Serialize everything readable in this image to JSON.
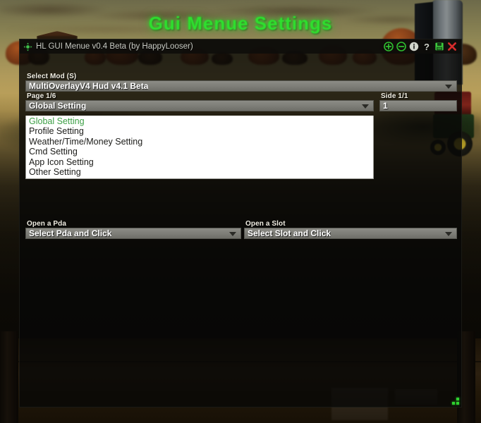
{
  "page": {
    "title": "Gui Menue Settings"
  },
  "window": {
    "titlebar": {
      "icon": "move-crosshair-icon",
      "title": "HL GUI Menue v0.4 Beta (by HappyLooser)",
      "buttons": [
        {
          "name": "zoom-in-button",
          "label": "+",
          "icon": "plus-circle-icon",
          "color": "#2fbf2f"
        },
        {
          "name": "zoom-out-button",
          "label": "−",
          "icon": "minus-circle-icon",
          "color": "#2fbf2f"
        },
        {
          "name": "info-button",
          "label": "i",
          "icon": "info-circle-icon",
          "color": "#d2d5cc"
        },
        {
          "name": "help-button",
          "label": "?",
          "icon": "question-mark-icon",
          "color": "#cfd2c9"
        },
        {
          "name": "save-button",
          "label": "Save",
          "icon": "floppy-disk-icon",
          "color": "#3ecb3e"
        },
        {
          "name": "close-button",
          "label": "✕",
          "icon": "close-x-icon",
          "color": "#d62c2c"
        }
      ]
    },
    "fields": {
      "select_mod": {
        "label": "Select Mod (S)",
        "value": "MultiOverlayV4 Hud v4.1 Beta",
        "icon": "chevron-down-icon"
      },
      "page": {
        "label": "Page 1/6",
        "value": "Global Setting",
        "icon": "chevron-down-icon",
        "options": [
          "Global Setting",
          "Profile Setting",
          "Weather/Time/Money Setting",
          "Cmd Setting",
          "App Icon Setting",
          "Other Setting"
        ],
        "selected_index": 0,
        "expanded": true
      },
      "side": {
        "label": "Side 1/1",
        "value": "1",
        "placeholder": "1"
      },
      "open_pda": {
        "label": "Open a Pda",
        "value": "Select Pda and Click",
        "icon": "chevron-down-icon"
      },
      "open_slot": {
        "label": "Open a Slot",
        "value": "Select Slot and Click",
        "icon": "chevron-down-icon"
      }
    },
    "resize_grip": "resize-grip"
  },
  "colors": {
    "title_green": "#2ee02e",
    "list_selected_green": "#3c9f45",
    "close_red": "#d62c2c",
    "accent_green": "#3ecb3e",
    "control_grey": "#7e7e78"
  }
}
